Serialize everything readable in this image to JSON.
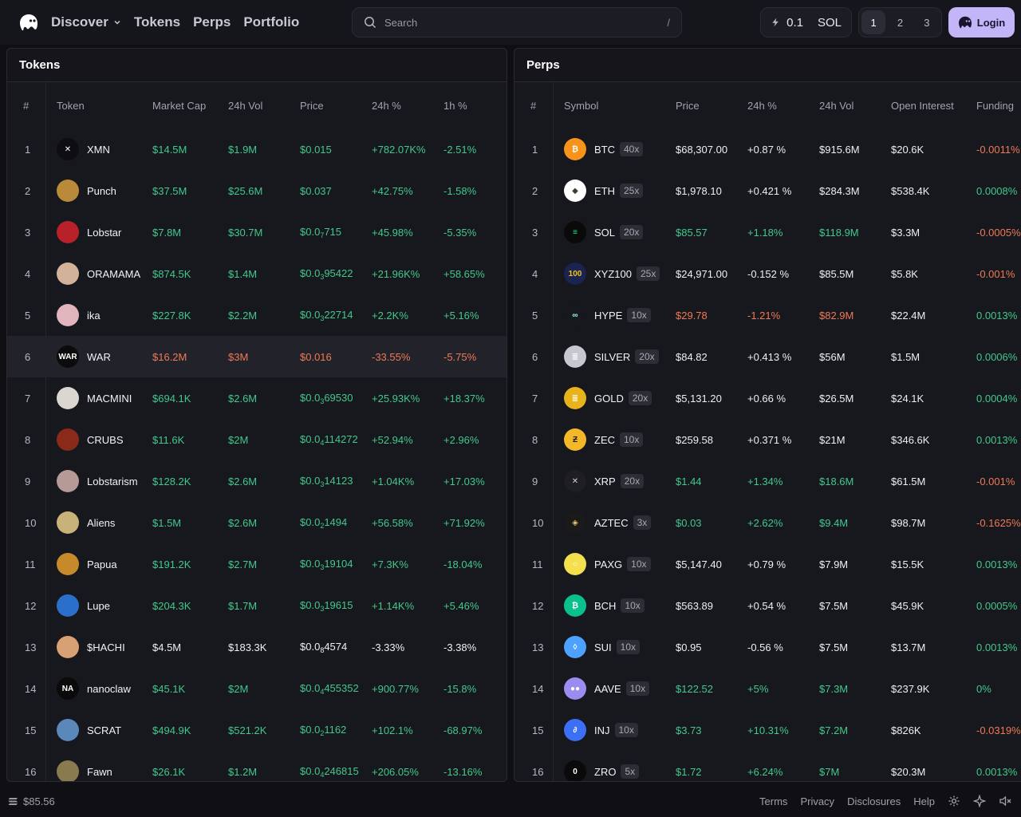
{
  "header": {
    "nav": [
      "Discover",
      "Tokens",
      "Perps",
      "Portfolio"
    ],
    "search_placeholder": "Search",
    "search_shortcut": "/",
    "sol_amount": "0.1",
    "sol_unit": "SOL",
    "presets": [
      "1",
      "2",
      "3"
    ],
    "login_label": "Login"
  },
  "tokens": {
    "title": "Tokens",
    "columns": [
      "#",
      "Token",
      "Market Cap",
      "24h Vol",
      "Price",
      "24h %",
      "1h %"
    ],
    "rows": [
      {
        "n": "1",
        "name": "XMN",
        "mcap": "$14.5M",
        "vol": "$1.9M",
        "price": "$0.015",
        "d24": "+782.07K%",
        "d1": "-2.51%",
        "mc": "g",
        "vc": "g",
        "pc": "g",
        "c24": "g",
        "c1": "g",
        "av": "#0e0e12",
        "avtxt": "✕"
      },
      {
        "n": "2",
        "name": "Punch",
        "mcap": "$37.5M",
        "vol": "$25.6M",
        "price": "$0.037",
        "d24": "+42.75%",
        "d1": "-1.58%",
        "mc": "g",
        "vc": "g",
        "pc": "g",
        "c24": "g",
        "c1": "g",
        "av": "#b98a3a",
        "avtxt": ""
      },
      {
        "n": "3",
        "name": "Lobstar",
        "mcap": "$7.8M",
        "vol": "$30.7M",
        "price_pre": "$0.0",
        "price_sub": "7",
        "price_post": "715",
        "d24": "+45.98%",
        "d1": "-5.35%",
        "mc": "g",
        "vc": "g",
        "pc": "g",
        "c24": "g",
        "c1": "g",
        "av": "#b8202a",
        "avtxt": ""
      },
      {
        "n": "4",
        "name": "ORAMAMA",
        "mcap": "$874.5K",
        "vol": "$1.4M",
        "price_pre": "$0.0",
        "price_sub": "3",
        "price_post": "95422",
        "d24": "+21.96K%",
        "d1": "+58.65%",
        "mc": "g",
        "vc": "g",
        "pc": "g",
        "c24": "g",
        "c1": "g",
        "av": "#d2b39a",
        "avtxt": ""
      },
      {
        "n": "5",
        "name": "ika",
        "mcap": "$227.8K",
        "vol": "$2.2M",
        "price_pre": "$0.0",
        "price_sub": "3",
        "price_post": "22714",
        "d24": "+2.2K%",
        "d1": "+5.16%",
        "mc": "g",
        "vc": "g",
        "pc": "g",
        "c24": "g",
        "c1": "g",
        "av": "#e2b5bd",
        "avtxt": ""
      },
      {
        "n": "6",
        "name": "WAR",
        "mcap": "$16.2M",
        "vol": "$3M",
        "price": "$0.016",
        "d24": "-33.55%",
        "d1": "-5.75%",
        "mc": "r",
        "vc": "r",
        "pc": "r",
        "c24": "r",
        "c1": "r",
        "av": "#0b0b0b",
        "avtxt": "WAR",
        "hl": true
      },
      {
        "n": "7",
        "name": "MACMINI",
        "mcap": "$694.1K",
        "vol": "$2.6M",
        "price_pre": "$0.0",
        "price_sub": "3",
        "price_post": "69530",
        "d24": "+25.93K%",
        "d1": "+18.37%",
        "mc": "g",
        "vc": "g",
        "pc": "g",
        "c24": "g",
        "c1": "g",
        "av": "#dad6d0",
        "avtxt": ""
      },
      {
        "n": "8",
        "name": "CRUBS",
        "mcap": "$11.6K",
        "vol": "$2M",
        "price_pre": "$0.0",
        "price_sub": "4",
        "price_post": "114272",
        "d24": "+52.94%",
        "d1": "+2.96%",
        "mc": "g",
        "vc": "g",
        "pc": "g",
        "c24": "g",
        "c1": "g",
        "av": "#8a2a1a",
        "avtxt": ""
      },
      {
        "n": "9",
        "name": "Lobstarism",
        "mcap": "$128.2K",
        "vol": "$2.6M",
        "price_pre": "$0.0",
        "price_sub": "3",
        "price_post": "14123",
        "d24": "+1.04K%",
        "d1": "+17.03%",
        "mc": "g",
        "vc": "g",
        "pc": "g",
        "c24": "g",
        "c1": "g",
        "av": "#b59a95",
        "avtxt": ""
      },
      {
        "n": "10",
        "name": "Aliens",
        "mcap": "$1.5M",
        "vol": "$2.6M",
        "price_pre": "$0.0",
        "price_sub": "2",
        "price_post": "1494",
        "d24": "+56.58%",
        "d1": "+71.92%",
        "mc": "g",
        "vc": "g",
        "pc": "g",
        "c24": "g",
        "c1": "g",
        "av": "#c9b27a",
        "avtxt": ""
      },
      {
        "n": "11",
        "name": "Papua",
        "mcap": "$191.2K",
        "vol": "$2.7M",
        "price_pre": "$0.0",
        "price_sub": "3",
        "price_post": "19104",
        "d24": "+7.3K%",
        "d1": "-18.04%",
        "mc": "g",
        "vc": "g",
        "pc": "g",
        "c24": "g",
        "c1": "g",
        "av": "#c78a2a",
        "avtxt": ""
      },
      {
        "n": "12",
        "name": "Lupe",
        "mcap": "$204.3K",
        "vol": "$1.7M",
        "price_pre": "$0.0",
        "price_sub": "3",
        "price_post": "19615",
        "d24": "+1.14K%",
        "d1": "+5.46%",
        "mc": "g",
        "vc": "g",
        "pc": "g",
        "c24": "g",
        "c1": "g",
        "av": "#2a6fc9",
        "avtxt": ""
      },
      {
        "n": "13",
        "name": "$HACHI",
        "mcap": "$4.5M",
        "vol": "$183.3K",
        "price_pre": "$0.0",
        "price_sub": "8",
        "price_post": "4574",
        "d24": "-3.33%",
        "d1": "-3.38%",
        "mc": "w",
        "vc": "w",
        "pc": "w",
        "c24": "w",
        "c1": "w",
        "av": "#d9a074",
        "avtxt": ""
      },
      {
        "n": "14",
        "name": "nanoclaw",
        "mcap": "$45.1K",
        "vol": "$2M",
        "price_pre": "$0.0",
        "price_sub": "4",
        "price_post": "455352",
        "d24": "+900.77%",
        "d1": "-15.8%",
        "mc": "g",
        "vc": "g",
        "pc": "g",
        "c24": "g",
        "c1": "g",
        "av": "#0a0a0a",
        "avtxt": "NA"
      },
      {
        "n": "15",
        "name": "SCRAT",
        "mcap": "$494.9K",
        "vol": "$521.2K",
        "price_pre": "$0.0",
        "price_sub": "2",
        "price_post": "1162",
        "d24": "+102.1%",
        "d1": "-68.97%",
        "mc": "g",
        "vc": "g",
        "pc": "g",
        "c24": "g",
        "c1": "g",
        "av": "#5a88b8",
        "avtxt": ""
      },
      {
        "n": "16",
        "name": "Fawn",
        "mcap": "$26.1K",
        "vol": "$1.2M",
        "price_pre": "$0.0",
        "price_sub": "4",
        "price_post": "246815",
        "d24": "+206.05%",
        "d1": "-13.16%",
        "mc": "g",
        "vc": "g",
        "pc": "g",
        "c24": "g",
        "c1": "g",
        "av": "#8a7a50",
        "avtxt": ""
      }
    ]
  },
  "perps": {
    "title": "Perps",
    "columns": [
      "#",
      "Symbol",
      "Price",
      "24h %",
      "24h Vol",
      "Open Interest",
      "Funding"
    ],
    "rows": [
      {
        "n": "1",
        "sym": "BTC",
        "lev": "40x",
        "price": "$68,307.00",
        "d24": "+0.87 %",
        "vol": "$915.6M",
        "oi": "$20.6K",
        "fund": "-0.0011%",
        "pc": "w",
        "c24": "w",
        "vc": "w",
        "fc": "r",
        "av": "#f7931a",
        "avtxt": "₿"
      },
      {
        "n": "2",
        "sym": "ETH",
        "lev": "25x",
        "price": "$1,978.10",
        "d24": "+0.421 %",
        "vol": "$284.3M",
        "oi": "$538.4K",
        "fund": "0.0008%",
        "pc": "w",
        "c24": "w",
        "vc": "w",
        "fc": "g",
        "av": "#ffffff",
        "avtxt": "◆",
        "avcol": "#3c3c3d"
      },
      {
        "n": "3",
        "sym": "SOL",
        "lev": "20x",
        "price": "$85.57",
        "d24": "+1.18%",
        "vol": "$118.9M",
        "oi": "$3.3M",
        "fund": "-0.0005%",
        "pc": "g",
        "c24": "g",
        "vc": "g",
        "fc": "r",
        "av": "#0a0a0a",
        "avtxt": "≡",
        "avcol": "#14f195"
      },
      {
        "n": "4",
        "sym": "XYZ100",
        "lev": "25x",
        "price": "$24,971.00",
        "d24": "-0.152 %",
        "vol": "$85.5M",
        "oi": "$5.8K",
        "fund": "-0.001%",
        "pc": "w",
        "c24": "w",
        "vc": "w",
        "fc": "r",
        "av": "#1b2350",
        "avtxt": "100",
        "avcol": "#f0c419"
      },
      {
        "n": "5",
        "sym": "HYPE",
        "lev": "10x",
        "price": "$29.78",
        "d24": "-1.21%",
        "vol": "$82.9M",
        "oi": "$22.4M",
        "fund": "0.0013%",
        "pc": "r",
        "c24": "r",
        "vc": "r",
        "fc": "g",
        "av": "#17171e",
        "avtxt": "∞",
        "avcol": "#97fce4"
      },
      {
        "n": "6",
        "sym": "SILVER",
        "lev": "20x",
        "price": "$84.82",
        "d24": "+0.413 %",
        "vol": "$56M",
        "oi": "$1.5M",
        "fund": "0.0006%",
        "pc": "w",
        "c24": "w",
        "vc": "w",
        "fc": "g",
        "av": "#c7c7cf",
        "avtxt": "≣",
        "avcol": "#ffffff"
      },
      {
        "n": "7",
        "sym": "GOLD",
        "lev": "20x",
        "price": "$5,131.20",
        "d24": "+0.66 %",
        "vol": "$26.5M",
        "oi": "$24.1K",
        "fund": "0.0004%",
        "pc": "w",
        "c24": "w",
        "vc": "w",
        "fc": "g",
        "av": "#e8b21a",
        "avtxt": "≣",
        "avcol": "#ffffff"
      },
      {
        "n": "8",
        "sym": "ZEC",
        "lev": "10x",
        "price": "$259.58",
        "d24": "+0.371 %",
        "vol": "$21M",
        "oi": "$346.6K",
        "fund": "0.0013%",
        "pc": "w",
        "c24": "w",
        "vc": "w",
        "fc": "g",
        "av": "#f4b728",
        "avtxt": "Ƶ",
        "avcol": "#1a1a1a"
      },
      {
        "n": "9",
        "sym": "XRP",
        "lev": "20x",
        "price": "$1.44",
        "d24": "+1.34%",
        "vol": "$18.6M",
        "oi": "$61.5M",
        "fund": "-0.001%",
        "pc": "g",
        "c24": "g",
        "vc": "g",
        "fc": "r",
        "av": "#1e1e24",
        "avtxt": "✕",
        "avcol": "#cfcfd6"
      },
      {
        "n": "10",
        "sym": "AZTEC",
        "lev": "3x",
        "price": "$0.03",
        "d24": "+2.62%",
        "vol": "$9.4M",
        "oi": "$98.7M",
        "fund": "-0.1625%",
        "pc": "g",
        "c24": "g",
        "vc": "g",
        "fc": "r",
        "av": "#1a1a1a",
        "avtxt": "◈",
        "avcol": "#e8c46a"
      },
      {
        "n": "11",
        "sym": "PAXG",
        "lev": "10x",
        "price": "$5,147.40",
        "d24": "+0.79 %",
        "vol": "$7.9M",
        "oi": "$15.5K",
        "fund": "0.0013%",
        "pc": "w",
        "c24": "w",
        "vc": "w",
        "fc": "g",
        "av": "#f4e04d",
        "avtxt": "○",
        "avcol": "#ffffff"
      },
      {
        "n": "12",
        "sym": "BCH",
        "lev": "10x",
        "price": "$563.89",
        "d24": "+0.54 %",
        "vol": "$7.5M",
        "oi": "$45.9K",
        "fund": "0.0005%",
        "pc": "w",
        "c24": "w",
        "vc": "w",
        "fc": "g",
        "av": "#0ac18e",
        "avtxt": "₿",
        "avcol": "#ffffff"
      },
      {
        "n": "13",
        "sym": "SUI",
        "lev": "10x",
        "price": "$0.95",
        "d24": "-0.56 %",
        "vol": "$7.5M",
        "oi": "$13.7M",
        "fund": "0.0013%",
        "pc": "w",
        "c24": "w",
        "vc": "w",
        "fc": "g",
        "av": "#4da2ff",
        "avtxt": "◊",
        "avcol": "#ffffff"
      },
      {
        "n": "14",
        "sym": "AAVE",
        "lev": "10x",
        "price": "$122.52",
        "d24": "+5%",
        "vol": "$7.3M",
        "oi": "$237.9K",
        "fund": "0%",
        "pc": "g",
        "c24": "g",
        "vc": "g",
        "fc": "g",
        "av": "#9a8df2",
        "avtxt": "●●",
        "avcol": "#ffffff"
      },
      {
        "n": "15",
        "sym": "INJ",
        "lev": "10x",
        "price": "$3.73",
        "d24": "+10.31%",
        "vol": "$7.2M",
        "oi": "$826K",
        "fund": "-0.0319%",
        "pc": "g",
        "c24": "g",
        "vc": "g",
        "fc": "r",
        "av": "#3b6ff5",
        "avtxt": "∂",
        "avcol": "#ffffff"
      },
      {
        "n": "16",
        "sym": "ZRO",
        "lev": "5x",
        "price": "$1.72",
        "d24": "+6.24%",
        "vol": "$7M",
        "oi": "$20.3M",
        "fund": "0.0013%",
        "pc": "g",
        "c24": "g",
        "vc": "g",
        "fc": "g",
        "av": "#0a0a0a",
        "avtxt": "0",
        "avcol": "#ffffff"
      }
    ]
  },
  "footer": {
    "sol_price": "$85.56",
    "links": [
      "Terms",
      "Privacy",
      "Disclosures",
      "Help"
    ]
  },
  "colors": {
    "accent": "#c3b5f7",
    "positive": "#42c98b",
    "negative": "#ef7a55",
    "background": "#101014"
  }
}
